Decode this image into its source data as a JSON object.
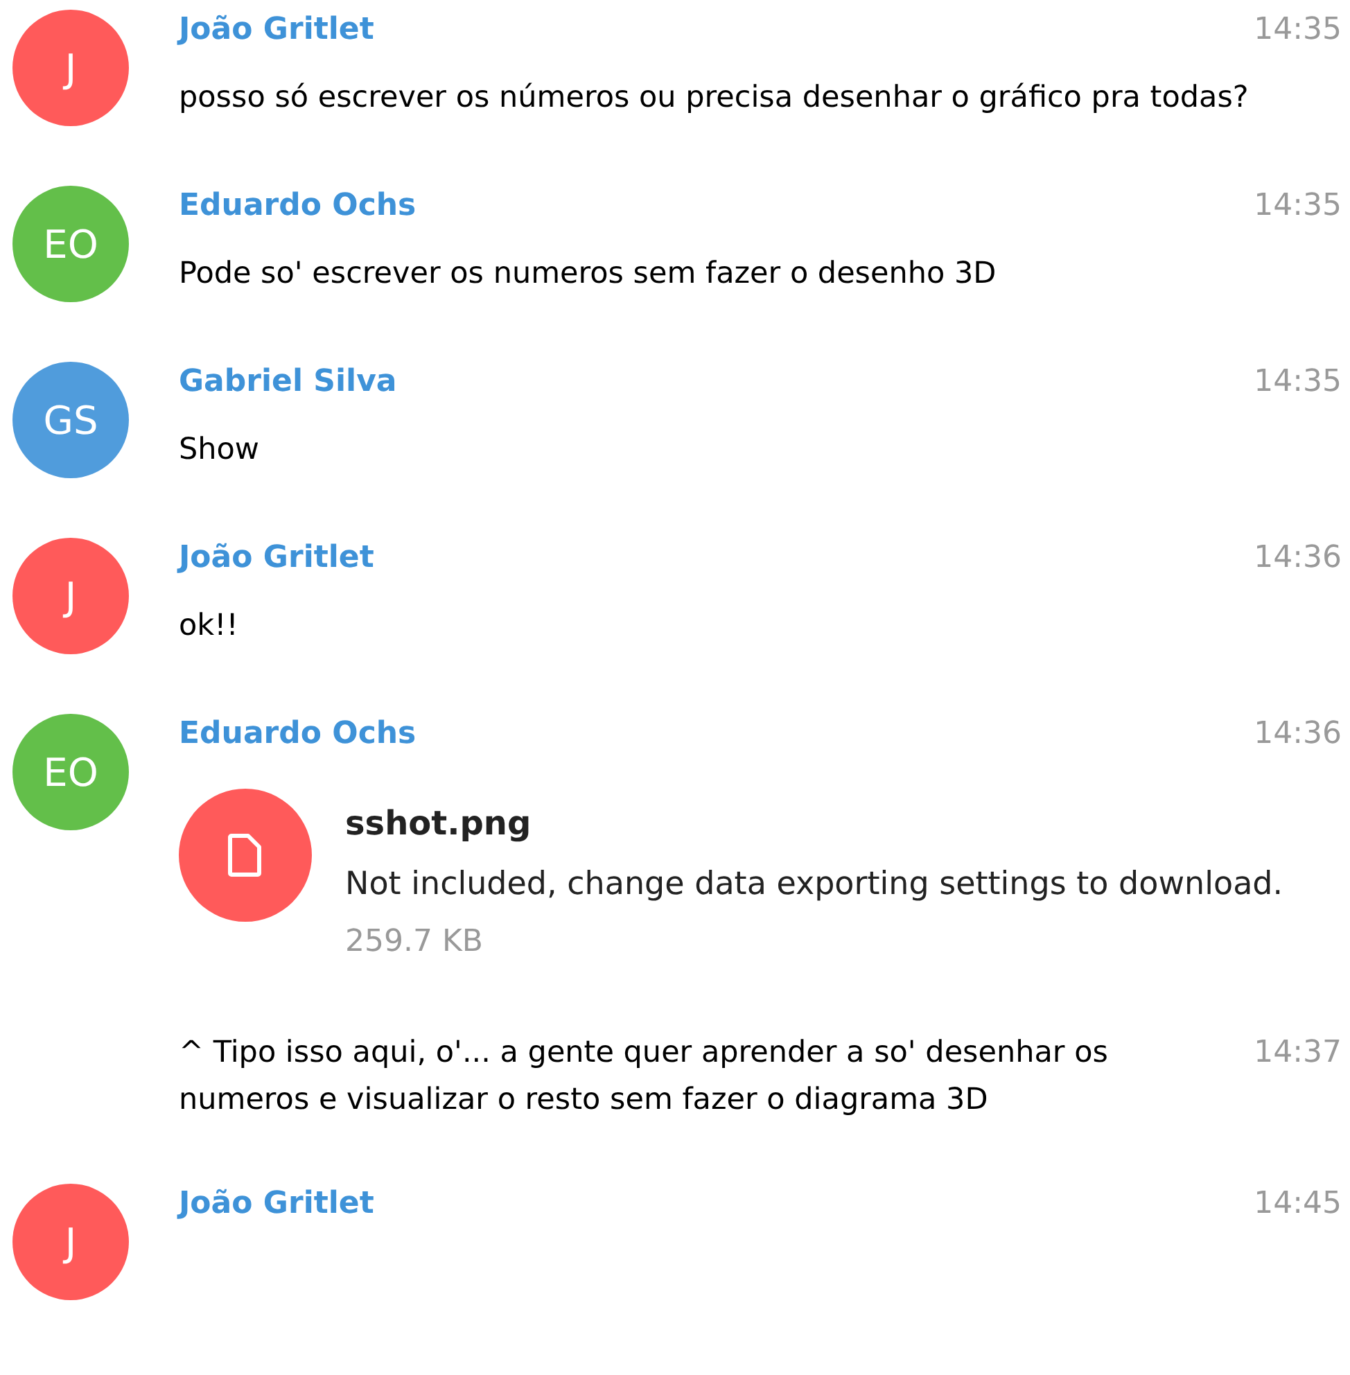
{
  "messages": [
    {
      "kind": "message",
      "avatar": {
        "initials": "J",
        "color": "#ff5a5a"
      },
      "author": "João Gritlet",
      "time": "14:35",
      "text": "posso só escrever os números ou precisa desenhar o gráfico pra todas?"
    },
    {
      "kind": "message",
      "avatar": {
        "initials": "EO",
        "color": "#63bf4a"
      },
      "author": "Eduardo Ochs",
      "time": "14:35",
      "text": "Pode so' escrever os numeros sem fazer o desenho 3D"
    },
    {
      "kind": "message",
      "avatar": {
        "initials": "GS",
        "color": "#509cdc"
      },
      "author": "Gabriel Silva",
      "time": "14:35",
      "text": "Show"
    },
    {
      "kind": "message",
      "avatar": {
        "initials": "J",
        "color": "#ff5a5a"
      },
      "author": "João Gritlet",
      "time": "14:36",
      "text": "ok!!"
    },
    {
      "kind": "message",
      "avatar": {
        "initials": "EO",
        "color": "#63bf4a"
      },
      "author": "Eduardo Ochs",
      "time": "14:36",
      "file": {
        "name": "sshot.png",
        "note": "Not included, change data exporting settings to download.",
        "size": "259.7 KB"
      }
    },
    {
      "kind": "joined",
      "time": "14:37",
      "text": "^ Tipo isso aqui, o'... a gente quer aprender a so' desenhar os numeros e visualizar o resto sem fazer o diagrama 3D"
    },
    {
      "kind": "message",
      "avatar": {
        "initials": "J",
        "color": "#ff5a5a"
      },
      "author": "João Gritlet",
      "time": "14:45"
    }
  ]
}
